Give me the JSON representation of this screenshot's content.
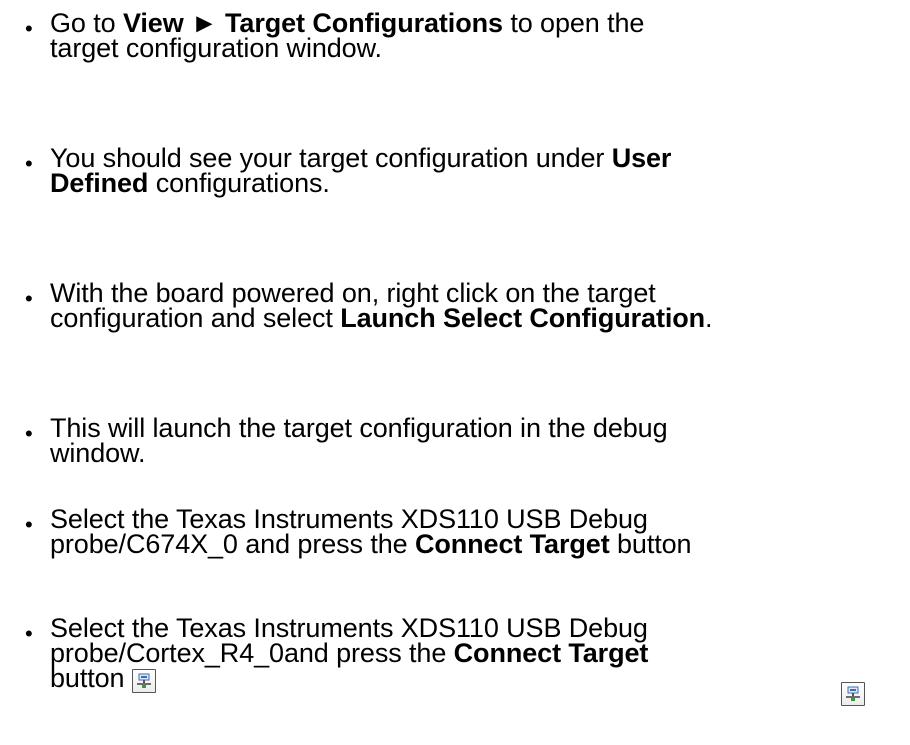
{
  "bullets": [
    {
      "b1_t1": "Go to ",
      "b1_b1": "View ► Target Configurations",
      "b1_t2": " to open the",
      "b1_t3": "target configuration window."
    }
  ],
  "b2": {
    "t1": "You should see your target configuration under ",
    "b1": "User",
    "b2": "Defined",
    "t2": " configurations."
  },
  "b3": {
    "t1": "With the board powered on, right click on the target",
    "t2": "configuration and select ",
    "b1": "Launch Select Configuration",
    "t3": "."
  },
  "b4": {
    "t1": "This will launch the target configuration in the debug",
    "t2": "window."
  },
  "b5": {
    "t1": "Select the Texas Instruments XDS110 USB Debug",
    "t2": "probe/C674X_0 and press the ",
    "b1": "Connect Target",
    "t3": " button",
    "icon": "connect-target-icon"
  },
  "b6": {
    "t1": "Select the Texas Instruments XDS110 USB Debug",
    "t2": "probe/Cortex_R4_0and press the ",
    "b1": "Connect Target",
    "t3": "button",
    "icon": "connect-target-icon"
  },
  "bullet_char": "•"
}
